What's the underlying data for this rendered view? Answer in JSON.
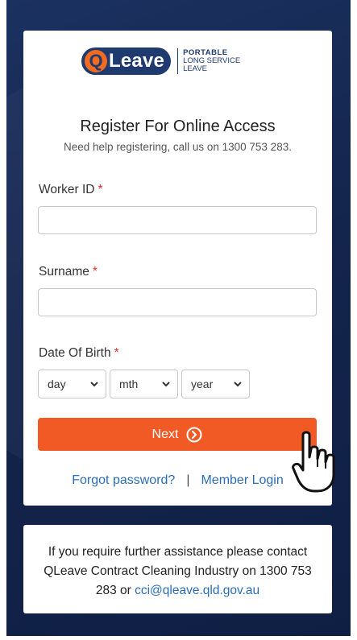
{
  "logo": {
    "q_letter": "Q",
    "word": "Leave",
    "tag_line1": "PORTABLE",
    "tag_line2": "LONG SERVICE",
    "tag_line3": "LEAVE"
  },
  "header": {
    "title": "Register For Online Access",
    "subtitle": "Need help registering, call us on 1300 753 283."
  },
  "form": {
    "worker_id_label": "Worker ID",
    "surname_label": "Surname",
    "dob_label": "Date Of Birth",
    "required_mark": "*",
    "worker_id_value": "",
    "surname_value": "",
    "day_value": "day",
    "month_value": "mth",
    "year_value": "year"
  },
  "actions": {
    "next_label": "Next",
    "forgot_password": "Forgot password?",
    "separator": "|",
    "member_login": "Member Login"
  },
  "assistance": {
    "text": "If you require further assistance please contact QLeave Contract Cleaning Industry on 1300 753 283 or",
    "email": "cci@qleave.qld.gov.au"
  },
  "colors": {
    "background": "#14254d",
    "accent": "#f15a24",
    "link": "#2a6db5",
    "required": "#e0312b",
    "logo_navy": "#1e3a6e"
  },
  "icons": {
    "next_icon": "circle-chevron-right-icon",
    "select_icon": "chevron-down-icon",
    "cursor_icon": "hand-pointer-cursor-icon"
  }
}
